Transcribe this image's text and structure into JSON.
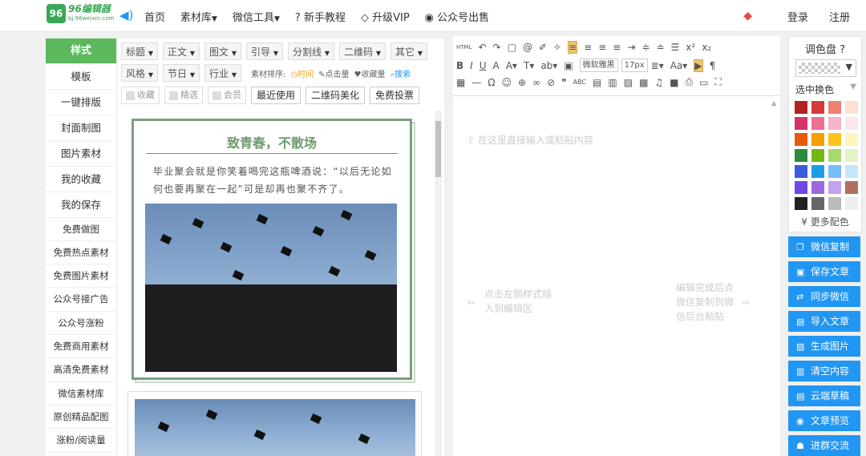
{
  "topbar": {
    "logo_mark": "96",
    "logo_name": "96编辑器",
    "logo_domain": "bj.96weixin.com",
    "nav": [
      "首页",
      "素材库",
      "微信工具",
      "新手教程",
      "升级VIP",
      "公众号出售"
    ],
    "login": "登录",
    "register": "注册"
  },
  "left_sidebar": {
    "items": [
      "样式",
      "模板",
      "一键排版",
      "封面制图",
      "图片素材",
      "我的收藏",
      "我的保存",
      "免费做图",
      "免费热点素材",
      "免费图片素材",
      "公众号接广告",
      "公众号涨粉",
      "免费商用素材",
      "高清免费素材",
      "微信素材库",
      "原创精品配图",
      "涨粉/阅读量"
    ]
  },
  "style_toolbar": {
    "row1": [
      "标题",
      "正文",
      "图文",
      "引导",
      "分割线",
      "二维码",
      "其它"
    ],
    "row2": [
      "风格",
      "节日",
      "行业"
    ],
    "sort_label": "素材排序:",
    "sort_time": "时间",
    "sort_clicks": "点击量",
    "sort_favs": "收藏量",
    "search": "搜索",
    "row3_checks": [
      "收藏",
      "精选",
      "会员"
    ],
    "row3_buttons": [
      "最近使用",
      "二维码美化",
      "免费投票"
    ]
  },
  "preview": {
    "card_title": "致青春，不散场",
    "card_text": "毕业聚会就是你笑着喝完这瓶啤酒说：“以后无论如何也要再聚在一起”可是却再也聚不齐了。"
  },
  "editor": {
    "placeholder": "在这里直接输入或粘贴内容",
    "hint_left": "点击左侧样式插入到编辑区",
    "hint_right": "编辑完成后点微信复制到微信后台粘贴",
    "font_name": "微软雅黑",
    "font_size": "17px"
  },
  "palette": {
    "title": "调色盘",
    "select_label": "选中换色",
    "more": "更多配色",
    "colors": [
      "#b22222",
      "#d83a3a",
      "#ee8070",
      "#fde0d4",
      "#d6336c",
      "#ee6e94",
      "#f7b3c7",
      "#fde6ee",
      "#e8590c",
      "#f59f00",
      "#fcc419",
      "#fff3bf",
      "#2b8a3e",
      "#74b816",
      "#a9d86e",
      "#e3f3c6",
      "#3b5bdb",
      "#1c9ee6",
      "#74c0fc",
      "#c5e6fb",
      "#7048e8",
      "#9c6ade",
      "#c3a3ec",
      "#b06f5f",
      "#222222",
      "#666666",
      "#bbbbbb",
      "#eeeeee"
    ]
  },
  "actions": [
    "微信复制",
    "保存文章",
    "同步微信",
    "导入文章",
    "生成图片",
    "清空内容",
    "云端草稿",
    "文章预览",
    "进群交流"
  ],
  "colors": {
    "accent_green": "#5cb85c",
    "action_blue": "#2196f3"
  }
}
